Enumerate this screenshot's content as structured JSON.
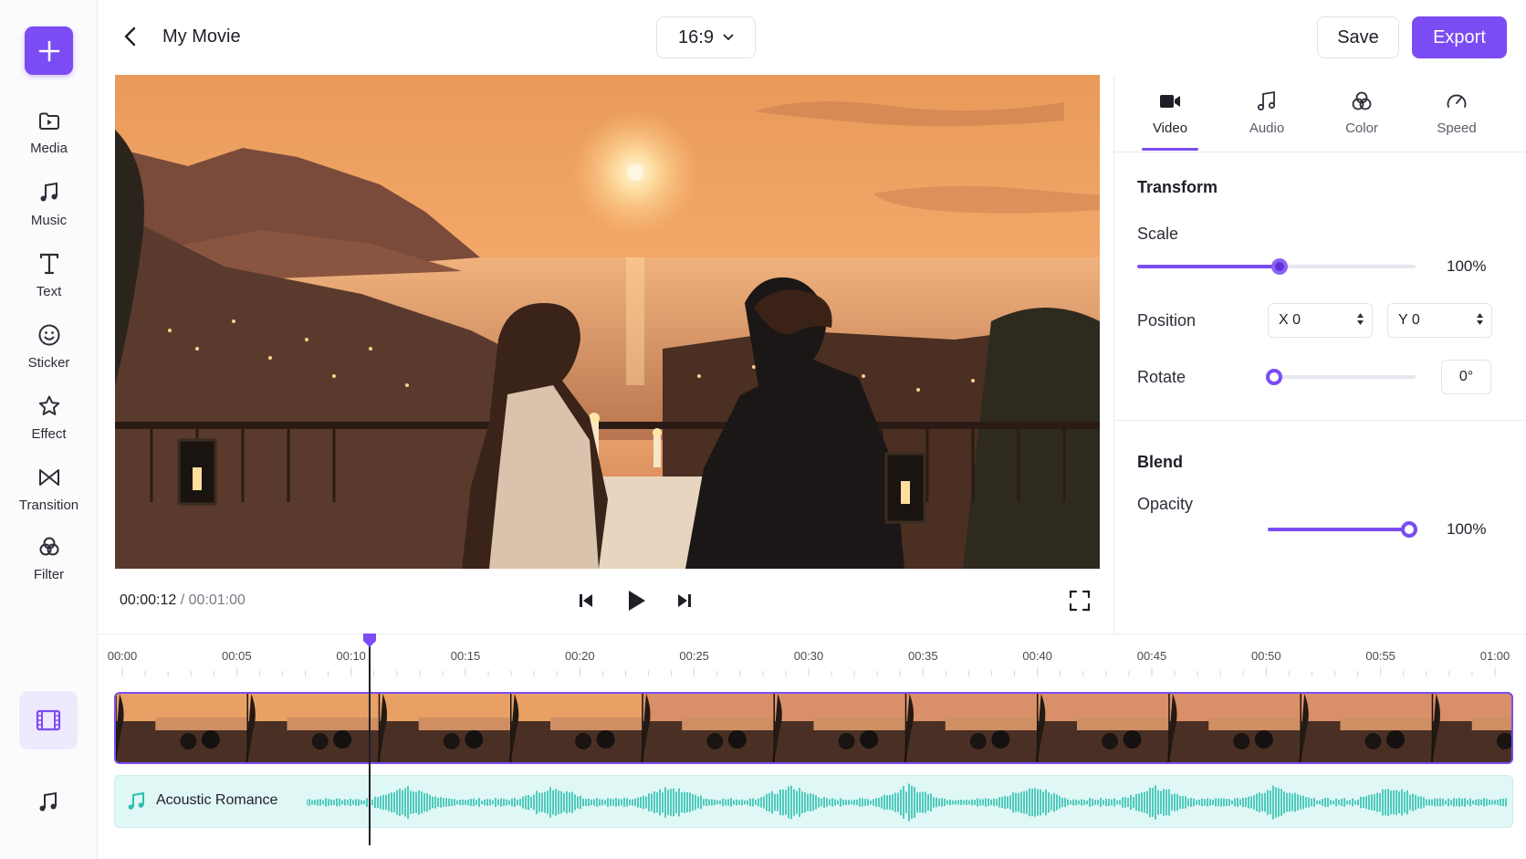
{
  "header": {
    "title": "My Movie",
    "aspect_ratio": "16:9",
    "save_label": "Save",
    "export_label": "Export"
  },
  "sidebar": {
    "items": [
      {
        "label": "Media",
        "icon": "media-folder-icon"
      },
      {
        "label": "Music",
        "icon": "music-note-icon"
      },
      {
        "label": "Text",
        "icon": "text-icon"
      },
      {
        "label": "Sticker",
        "icon": "smiley-icon"
      },
      {
        "label": "Effect",
        "icon": "star-icon"
      },
      {
        "label": "Transition",
        "icon": "bowtie-icon"
      },
      {
        "label": "Filter",
        "icon": "filter-icon"
      }
    ]
  },
  "player": {
    "current_time": "00:00:12",
    "separator": " / ",
    "duration": "00:01:00"
  },
  "panel": {
    "tabs": [
      {
        "label": "Video",
        "icon": "video-camera-icon",
        "active": true
      },
      {
        "label": "Audio",
        "icon": "music-note-icon",
        "active": false
      },
      {
        "label": "Color",
        "icon": "color-circles-icon",
        "active": false
      },
      {
        "label": "Speed",
        "icon": "speedometer-icon",
        "active": false
      }
    ],
    "transform": {
      "title": "Transform",
      "scale_label": "Scale",
      "scale_value": "100%",
      "scale_fraction": 0.51,
      "position_label": "Position",
      "position_x": "X 0",
      "position_y": "Y 0",
      "rotate_label": "Rotate",
      "rotate_value": "0°",
      "rotate_fraction": 0.0
    },
    "blend": {
      "title": "Blend",
      "opacity_label": "Opacity",
      "opacity_value": "100%",
      "opacity_fraction": 1.0
    }
  },
  "timeline": {
    "ticks": [
      "00:00",
      "00:05",
      "00:10",
      "00:15",
      "00:20",
      "00:25",
      "00:30",
      "00:35",
      "00:40",
      "00:45",
      "00:50",
      "00:55",
      "01:00"
    ],
    "playhead_seconds": 12,
    "audio_track_name": "Acoustic Romance"
  },
  "colors": {
    "accent": "#7b4cf3",
    "audio_wave": "#2cbfb1",
    "audio_bg": "#dff7f5"
  }
}
